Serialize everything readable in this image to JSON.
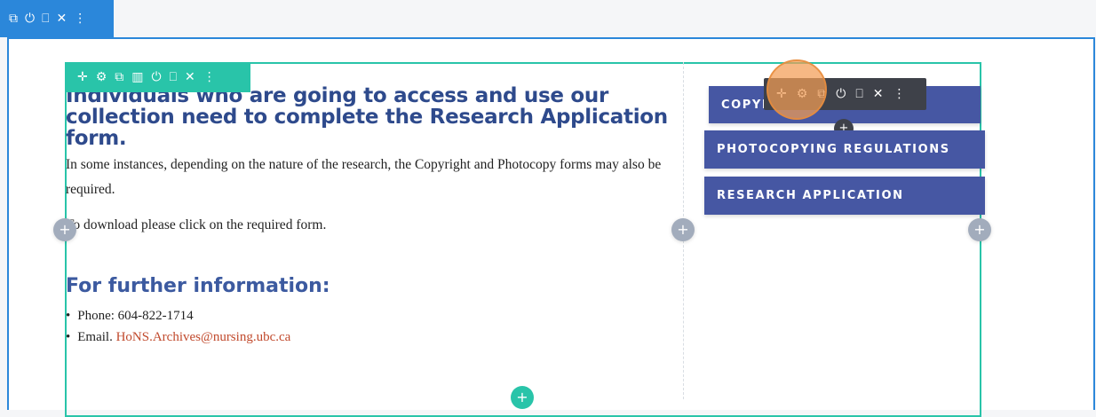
{
  "section_toolbar": {
    "icons": [
      "duplicate-icon",
      "power-icon",
      "trash-icon",
      "close-icon",
      "more-icon"
    ],
    "glyphs": [
      "⧉",
      "⏻",
      "⎕",
      "✕",
      "⋮"
    ]
  },
  "row_toolbar": {
    "glyphs": [
      "✛",
      "⚙",
      "⧉",
      "▥",
      "⏻",
      "⎕",
      "✕",
      "⋮"
    ]
  },
  "module_toolbar": {
    "glyphs": [
      "✛",
      "⚙",
      "⧉",
      "⏻",
      "⎕",
      "✕",
      "⋮"
    ]
  },
  "content": {
    "heading": "Individuals who are going to access and use our collection need to complete the Research Application form.",
    "para1": "In some instances, depending on the nature of the research, the Copyright and Photocopy forms may also be required.",
    "para2": "To download please click on the required form.",
    "sub_heading": "For further information:",
    "phone": "Phone: 604-822-1714",
    "email_prefix": "Email.",
    "email": "HoNS.Archives@nursing.ubc.ca"
  },
  "buttons": {
    "copyright": "COPYRIGHT",
    "photocopying": "PHOTOCOPYING REGULATIONS",
    "research": "RESEARCH APPLICATION"
  },
  "add_glyph": "+",
  "colors": {
    "section_blue": "#2b87da",
    "row_teal": "#29c4a9",
    "module_dark": "#3e4149",
    "button_blue": "#4657a3",
    "heading_blue": "#2e4a8c",
    "link_red": "#c14a2d",
    "highlight_orange": "#f39d55"
  }
}
